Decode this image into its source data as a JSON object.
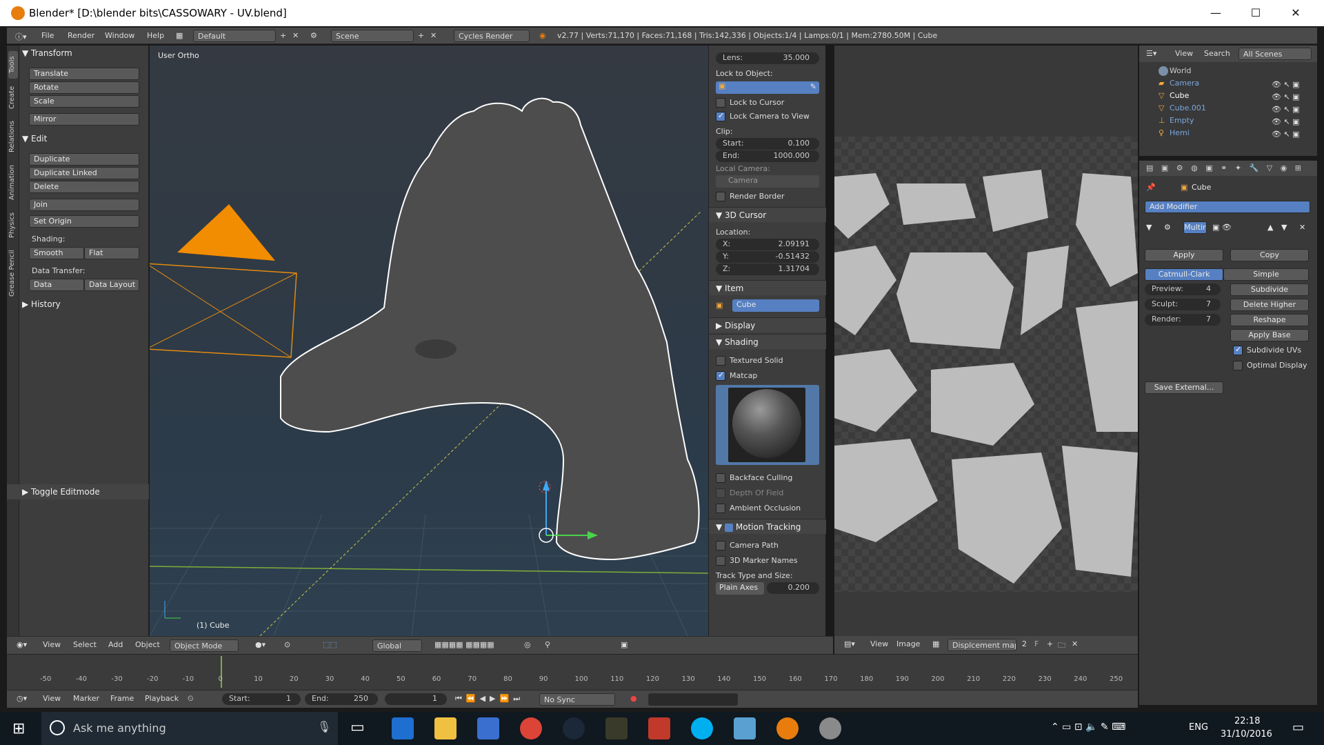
{
  "titlebar": {
    "title": "Blender* [D:\\blender bits\\CASSOWARY - UV.blend]",
    "minimize": "—",
    "maximize": "☐",
    "close": "✕"
  },
  "menubar": {
    "file": "File",
    "render": "Render",
    "window": "Window",
    "help": "Help",
    "layout": "Default",
    "scene": "Scene",
    "engine": "Cycles Render",
    "stats": "v2.77 | Verts:71,170 | Faces:71,168 | Tris:142,336 | Objects:1/4 | Lamps:0/1 | Mem:2780.50M | Cube"
  },
  "vtabs": [
    "Tools",
    "Create",
    "Relations",
    "Animation",
    "Physics",
    "Grease Pencil"
  ],
  "toolshelf": {
    "transform": "Transform",
    "translate": "Translate",
    "rotate": "Rotate",
    "scale": "Scale",
    "mirror": "Mirror",
    "edit": "Edit",
    "duplicate": "Duplicate",
    "duplicate_linked": "Duplicate Linked",
    "delete": "Delete",
    "join": "Join",
    "set_origin": "Set Origin",
    "shading": "Shading:",
    "smooth": "Smooth",
    "flat": "Flat",
    "data_transfer": "Data Transfer:",
    "data": "Data",
    "data_layout": "Data Layout",
    "history": "History",
    "toggle_editmode": "Toggle Editmode"
  },
  "viewport": {
    "view_label": "User Ortho",
    "object_label": "(1) Cube"
  },
  "vheader": {
    "view": "View",
    "select": "Select",
    "add": "Add",
    "object": "Object",
    "mode": "Object Mode",
    "orientation": "Global"
  },
  "npanel": {
    "lens_label": "Lens:",
    "lens_value": "35.000",
    "lock_to_object": "Lock to Object:",
    "lock_to_cursor": "Lock to Cursor",
    "lock_camera": "Lock Camera to View",
    "clip": "Clip:",
    "start_label": "Start:",
    "start_value": "0.100",
    "end_label": "End:",
    "end_value": "1000.000",
    "local_camera": "Local Camera:",
    "camera": "Camera",
    "render_border": "Render Border",
    "cursor_header": "3D Cursor",
    "location": "Location:",
    "x_label": "X:",
    "x_value": "2.09191",
    "y_label": "Y:",
    "y_value": "-0.51432",
    "z_label": "Z:",
    "z_value": "1.31704",
    "item_header": "Item",
    "item_name": "Cube",
    "display_header": "Display",
    "shading_header": "Shading",
    "textured_solid": "Textured Solid",
    "matcap": "Matcap",
    "backface": "Backface Culling",
    "dof": "Depth Of Field",
    "ao": "Ambient Occlusion",
    "motion_header": "Motion Tracking",
    "camera_path": "Camera Path",
    "marker_names": "3D Marker Names",
    "track_type": "Track Type and Size:",
    "plain_axes": "Plain Axes",
    "track_size": "0.200"
  },
  "outliner": {
    "view": "View",
    "search": "Search",
    "all_scenes": "All Scenes",
    "items": [
      "World",
      "Camera",
      "Cube",
      "Cube.001",
      "Empty",
      "Hemi"
    ]
  },
  "props": {
    "object": "Cube",
    "add_modifier": "Add Modifier",
    "mod_name": "Multir",
    "apply": "Apply",
    "copy": "Copy",
    "catmull": "Catmull-Clark",
    "simple": "Simple",
    "preview_label": "Preview:",
    "preview_value": "4",
    "sculpt_label": "Sculpt:",
    "sculpt_value": "7",
    "render_label": "Render:",
    "render_value": "7",
    "subdivide": "Subdivide",
    "delete_higher": "Delete Higher",
    "reshape": "Reshape",
    "apply_base": "Apply Base",
    "subdivide_uvs": "Subdivide UVs",
    "optimal_display": "Optimal Display",
    "save_external": "Save External..."
  },
  "uvheader": {
    "view": "View",
    "image": "Image",
    "image_name": "Displcement map p...",
    "users": "2",
    "fake": "F"
  },
  "timeline": {
    "ticks": [
      "-50",
      "-40",
      "-30",
      "-20",
      "-10",
      "0",
      "10",
      "20",
      "30",
      "40",
      "50",
      "60",
      "70",
      "80",
      "90",
      "100",
      "110",
      "120",
      "130",
      "140",
      "150",
      "160",
      "170",
      "180",
      "190",
      "200",
      "210",
      "220",
      "230",
      "240",
      "250"
    ]
  },
  "tlheader": {
    "view": "View",
    "marker": "Marker",
    "frame": "Frame",
    "playback": "Playback",
    "start_label": "Start:",
    "start_value": "1",
    "end_label": "End:",
    "end_value": "250",
    "current": "1",
    "sync": "No Sync"
  },
  "taskbar": {
    "search": "Ask me anything",
    "lang": "ENG",
    "time": "22:18",
    "date": "31/10/2016"
  }
}
